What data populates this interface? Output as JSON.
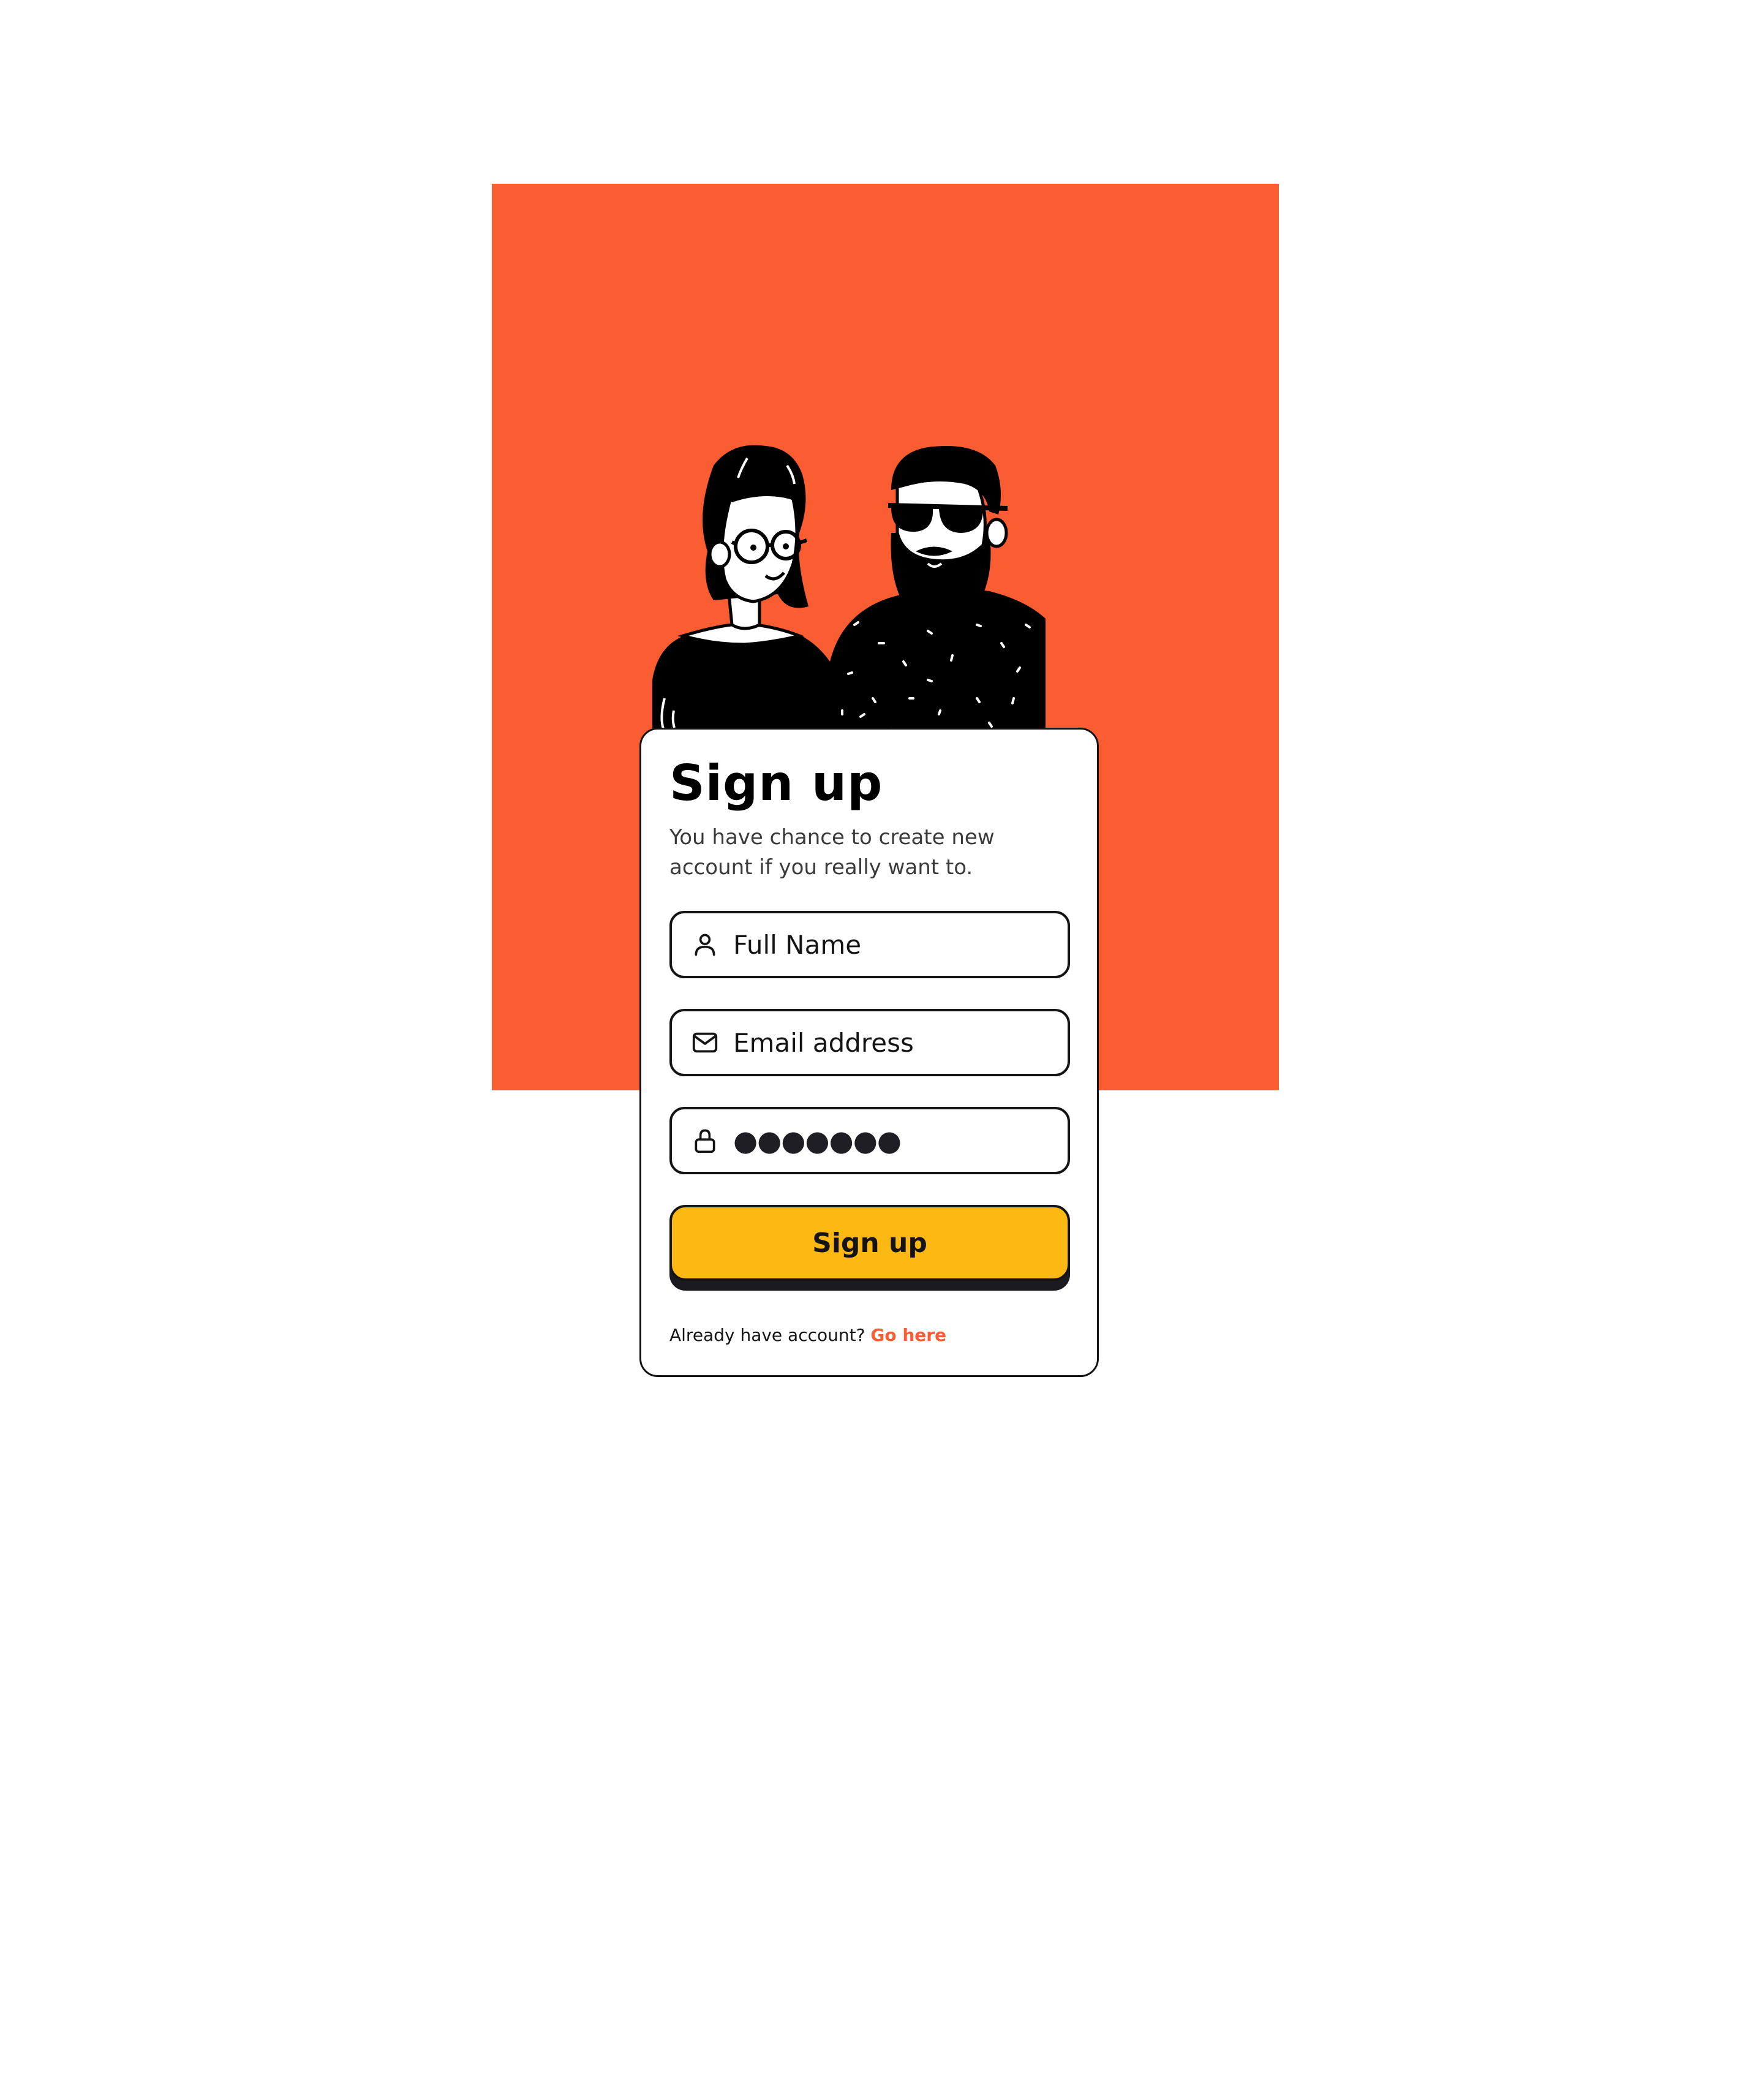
{
  "colors": {
    "hero_background": "#f95d31",
    "button_background": "#fdb913",
    "link": "#f95d31",
    "text": "#141414"
  },
  "illustration": {
    "subject": "two-people-illustration"
  },
  "signup": {
    "title": "Sign up",
    "subtitle": "You have chance to create new account if you really want to.",
    "fields": {
      "full_name": {
        "icon": "user-icon",
        "placeholder": "Full Name",
        "value": ""
      },
      "email": {
        "icon": "mail-icon",
        "placeholder": "Email address",
        "value": ""
      },
      "password": {
        "icon": "lock-icon",
        "masked_value": "●●●●●●●"
      }
    },
    "submit_label": "Sign up",
    "footer_text": "Already have account?",
    "footer_link": "Go here"
  }
}
